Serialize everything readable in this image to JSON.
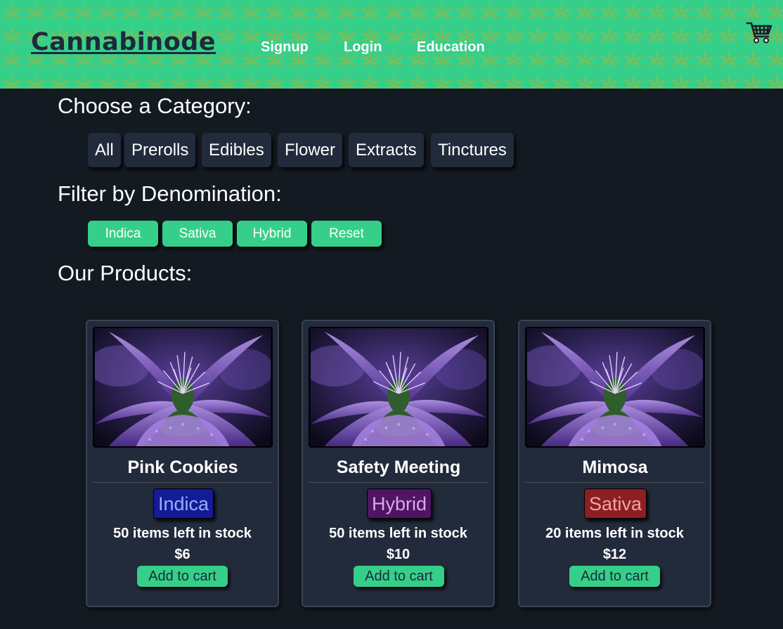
{
  "header": {
    "logo": "Cannabinode",
    "nav": [
      "Signup",
      "Login",
      "Education"
    ],
    "cart_icon": "shopping-cart-icon"
  },
  "categories": {
    "title": "Choose a Category:",
    "items": [
      "All",
      "Prerolls",
      "Edibles",
      "Flower",
      "Extracts",
      "Tinctures"
    ]
  },
  "denominations": {
    "title": "Filter by Denomination:",
    "items": [
      "Indica",
      "Sativa",
      "Hybrid",
      "Reset"
    ]
  },
  "products": {
    "title": "Our Products:",
    "add_label": "Add to cart",
    "items": [
      {
        "name": "Pink Cookies",
        "type": "Indica",
        "stock": "50 items left in stock",
        "price": "$6",
        "badge_bg": "#141b94",
        "badge_fg": "#8fb2ff"
      },
      {
        "name": "Safety Meeting",
        "type": "Hybrid",
        "stock": "50 items left in stock",
        "price": "$10",
        "badge_bg": "#4f1562",
        "badge_fg": "#d9a6ee"
      },
      {
        "name": "Mimosa",
        "type": "Sativa",
        "stock": "20 items left in stock",
        "price": "$12",
        "badge_bg": "#8b1f22",
        "badge_fg": "#f5a3a0"
      }
    ]
  },
  "colors": {
    "accent": "#36cf8a",
    "background": "#141a21",
    "card": "#222b3b"
  }
}
